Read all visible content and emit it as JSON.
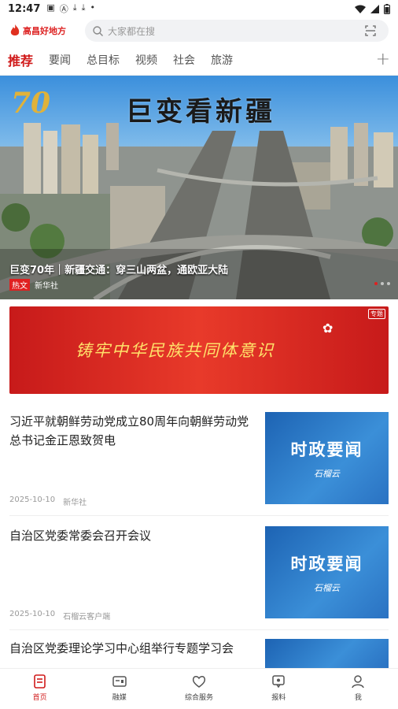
{
  "status": {
    "time": "12:47",
    "battery": ""
  },
  "header": {
    "logo_text": "高昌好地方",
    "search_placeholder": "大家都在搜"
  },
  "tabs": [
    {
      "label": "推荐",
      "active": true
    },
    {
      "label": "要闻"
    },
    {
      "label": "总目标"
    },
    {
      "label": "视频"
    },
    {
      "label": "社会"
    },
    {
      "label": "旅游"
    }
  ],
  "banner": {
    "badge": "70",
    "title": "巨变看新疆",
    "caption": "巨变70年｜新疆交通：穿三山两盆，通欧亚大陆",
    "tag": "热文",
    "source": "新华社"
  },
  "promo": {
    "text": "铸牢中华民族共同体意识",
    "tag": "专题"
  },
  "articles": [
    {
      "title": "习近平就朝鲜劳动党成立80周年向朝鲜劳动党总书记金正恩致贺电",
      "date": "2025-10-10",
      "source": "新华社",
      "thumb_title": "时政要闻",
      "thumb_sub": "石榴云"
    },
    {
      "title": "自治区党委常委会召开会议",
      "date": "2025-10-10",
      "source": "石榴云客户端",
      "thumb_title": "时政要闻",
      "thumb_sub": "石榴云"
    },
    {
      "title": "自治区党委理论学习中心组举行专题学习会",
      "date": "",
      "source": "",
      "thumb_title": "",
      "thumb_sub": ""
    }
  ],
  "bottom_nav": [
    {
      "label": "首页",
      "icon": "home-icon",
      "active": true
    },
    {
      "label": "融媒",
      "icon": "media-icon"
    },
    {
      "label": "综合服务",
      "icon": "service-icon"
    },
    {
      "label": "报料",
      "icon": "report-icon"
    },
    {
      "label": "我",
      "icon": "user-icon"
    }
  ],
  "colors": {
    "accent": "#d01a1a",
    "promo_red": "#d8261f",
    "thumb_blue": "#2a72c2"
  }
}
